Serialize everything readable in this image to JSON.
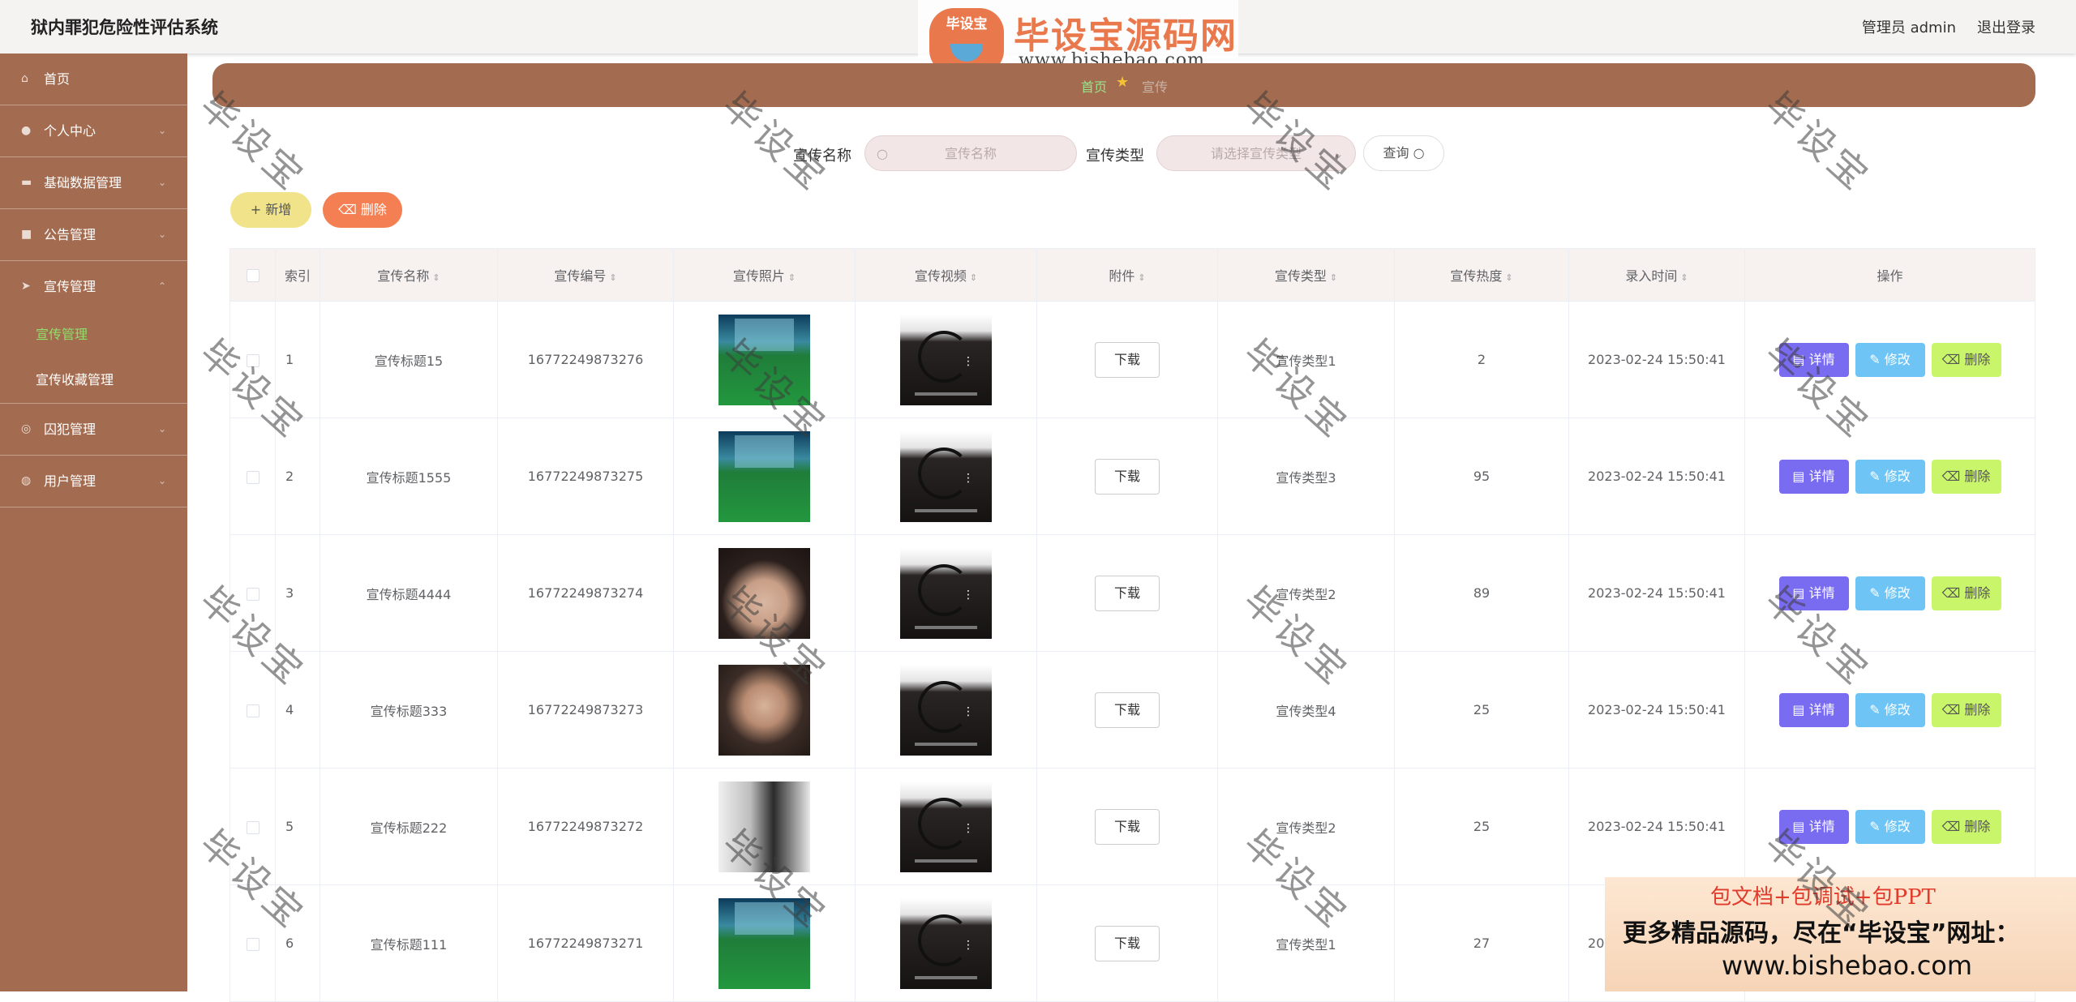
{
  "header": {
    "title": "狱内罪犯危险性评估系统",
    "admin_text": "管理员 admin",
    "logout_label": "退出登录"
  },
  "logo_watermark": {
    "badge": "毕设宝",
    "title": "毕设宝源码网",
    "url": "www.bishebao.com"
  },
  "sidebar": {
    "items": [
      {
        "label": "首页",
        "icon": "home-icon"
      },
      {
        "label": "个人中心",
        "icon": "user-icon"
      },
      {
        "label": "基础数据管理",
        "icon": "database-icon"
      },
      {
        "label": "公告管理",
        "icon": "notice-icon"
      },
      {
        "label": "宣传管理",
        "icon": "send-icon"
      },
      {
        "label": "囚犯管理",
        "icon": "prisoner-icon"
      },
      {
        "label": "用户管理",
        "icon": "users-icon"
      }
    ],
    "submenu": [
      {
        "label": "宣传管理",
        "active": true
      },
      {
        "label": "宣传收藏管理",
        "active": false
      }
    ]
  },
  "breadcrumb": {
    "home": "首页",
    "current": "宣传"
  },
  "search": {
    "name_label": "宣传名称",
    "name_placeholder": "宣传名称",
    "type_label": "宣传类型",
    "type_placeholder": "请选择宣传类型",
    "button_label": "查询"
  },
  "actions": {
    "add_label": "新增",
    "delete_label": "删除"
  },
  "table": {
    "columns": [
      "索引",
      "宣传名称",
      "宣传编号",
      "宣传照片",
      "宣传视频",
      "附件",
      "宣传类型",
      "宣传热度",
      "录入时间",
      "操作"
    ],
    "download_label": "下载",
    "op_labels": {
      "detail": "详情",
      "edit": "修改",
      "delete": "删除"
    },
    "rows": [
      {
        "index": "1",
        "name": "宣传标题15",
        "code": "16772249873276",
        "photo": "court",
        "type": "宣传类型1",
        "heat": "2",
        "time": "2023-02-24 15:50:41"
      },
      {
        "index": "2",
        "name": "宣传标题1555",
        "code": "16772249873275",
        "photo": "court",
        "type": "宣传类型3",
        "heat": "95",
        "time": "2023-02-24 15:50:41"
      },
      {
        "index": "3",
        "name": "宣传标题4444",
        "code": "16772249873274",
        "photo": "girl",
        "type": "宣传类型2",
        "heat": "89",
        "time": "2023-02-24 15:50:41"
      },
      {
        "index": "4",
        "name": "宣传标题333",
        "code": "16772249873273",
        "photo": "man",
        "type": "宣传类型4",
        "heat": "25",
        "time": "2023-02-24 15:50:41"
      },
      {
        "index": "5",
        "name": "宣传标题222",
        "code": "16772249873272",
        "photo": "bw",
        "type": "宣传类型2",
        "heat": "25",
        "time": "2023-02-24 15:50:41"
      },
      {
        "index": "6",
        "name": "宣传标题111",
        "code": "16772249873271",
        "photo": "court",
        "type": "宣传类型1",
        "heat": "27",
        "time": "2023-02-24 15:50:41"
      }
    ]
  },
  "promo": {
    "line1": "包文档+包调试+包PPT",
    "line2": "更多精品源码，尽在“毕设宝”网址：",
    "line3": "www.bishebao.com"
  },
  "watermark_text": "毕设宝",
  "colors": {
    "sidebar": "#a36b4f",
    "active_menu": "#8ee06a",
    "detail_btn": "#7a6cf0",
    "edit_btn": "#6ec5f5",
    "delete_btn": "#c9f56a",
    "add_btn": "#f0e38a",
    "bulk_delete_btn": "#f47f52"
  }
}
